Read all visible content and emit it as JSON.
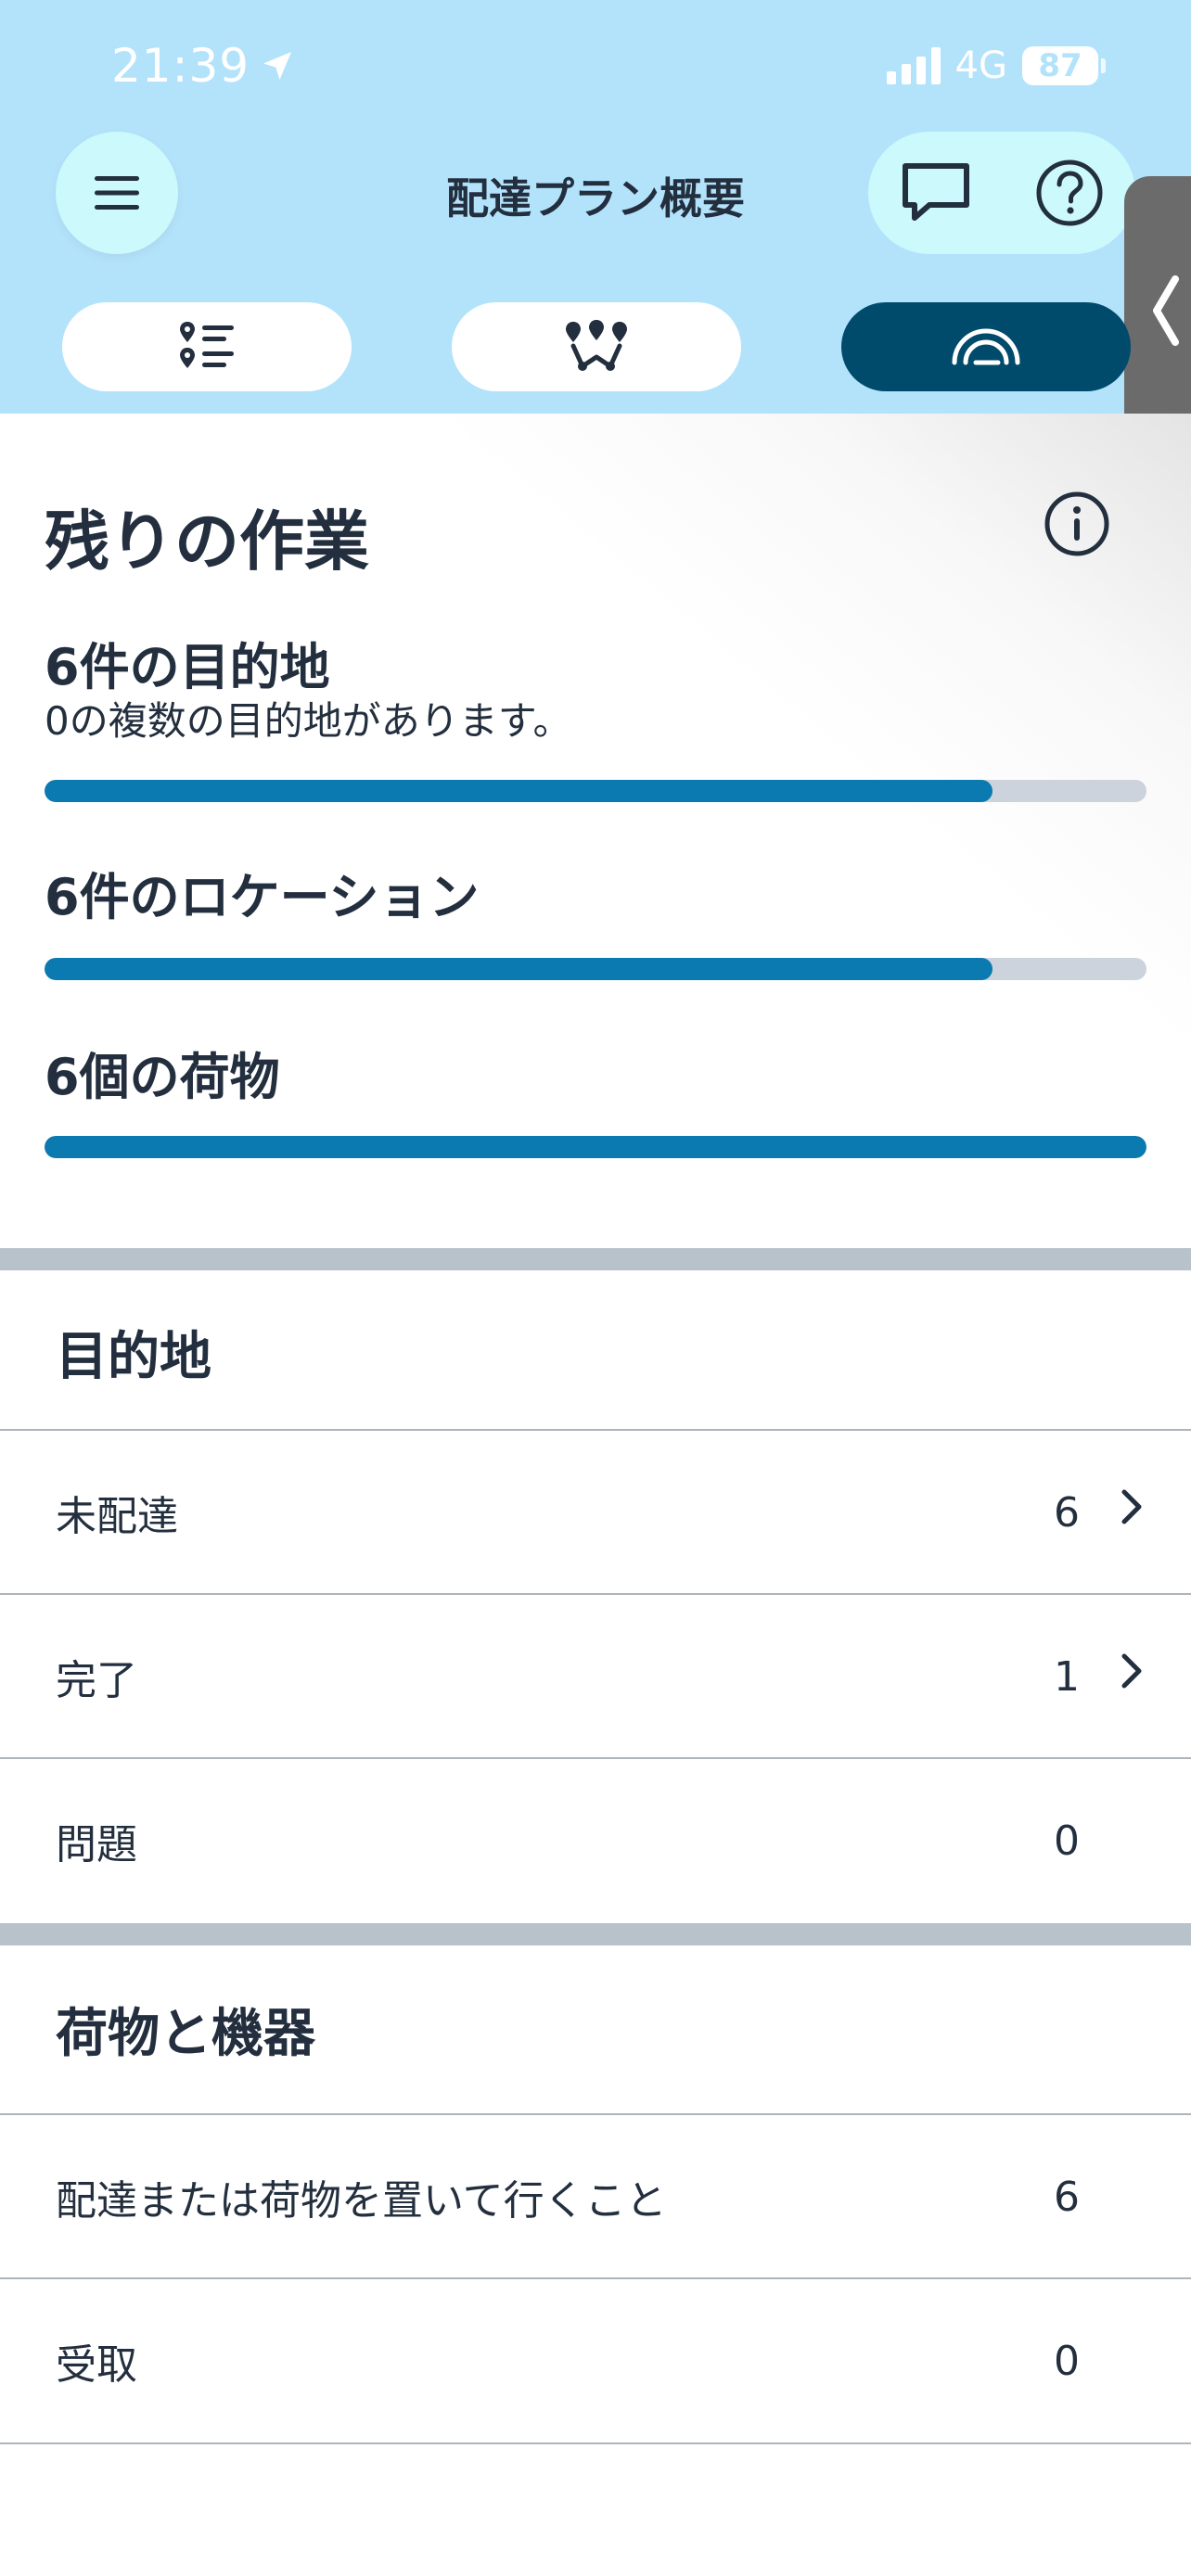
{
  "status_bar": {
    "time": "21:39",
    "network": "4G",
    "battery": "87"
  },
  "header": {
    "title": "配達プラン概要",
    "tabs": [
      {
        "icon": "list-pins-icon"
      },
      {
        "icon": "route-map-icon"
      },
      {
        "icon": "progress-gauge-icon",
        "active": true
      }
    ]
  },
  "remaining": {
    "title": "残りの作業",
    "metrics": [
      {
        "title": "6件の目的地",
        "subtitle": "0の複数の目的地があります。",
        "progress": 0.86
      },
      {
        "title": "6件のロケーション",
        "progress": 0.86
      },
      {
        "title": "6個の荷物",
        "progress": 1.0
      }
    ]
  },
  "destinations": {
    "title": "目的地",
    "rows": [
      {
        "label": "未配達",
        "count": "6"
      },
      {
        "label": "完了",
        "count": "1"
      },
      {
        "label": "問題",
        "count": "0"
      }
    ]
  },
  "packages": {
    "title": "荷物と機器",
    "rows": [
      {
        "label": "配達または荷物を置いて行くこと",
        "count": "6"
      },
      {
        "label": "受取",
        "count": "0"
      }
    ]
  },
  "colors": {
    "header_bg": "#b3e3fb",
    "accent_button": "#ccf9fb",
    "active_tab": "#004b6b",
    "progress_fill": "#0a7ab0",
    "progress_track": "#ccd3dc",
    "text": "#232f3e"
  }
}
